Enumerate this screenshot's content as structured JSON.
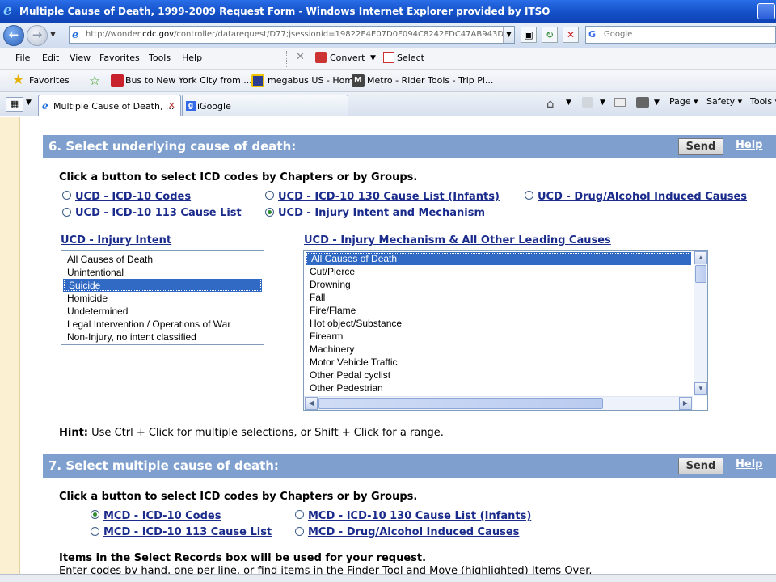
{
  "window": {
    "title": "Multiple Cause of Death, 1999-2009 Request Form - Windows Internet Explorer provided by ITSO"
  },
  "address": {
    "url_prefix": "http://wonder.",
    "url_domain": "cdc.gov",
    "url_rest": "/controller/datarequest/D77;jsessionid=19822E4E07D0F094C8242FDC47AB943D",
    "search_placeholder": "Google"
  },
  "menu": {
    "items": [
      "File",
      "Edit",
      "View",
      "Favorites",
      "Tools",
      "Help"
    ],
    "convert": "Convert",
    "select": "Select"
  },
  "favorites": {
    "label": "Favorites",
    "items": [
      "Bus to New York City from ...",
      "megabus US - Home",
      "Metro - Rider Tools - Trip Pl..."
    ]
  },
  "tabs": [
    {
      "label": "Multiple Cause of Death, ..."
    },
    {
      "label": "iGoogle"
    }
  ],
  "commandbar": {
    "page": "Page",
    "safety": "Safety",
    "tools": "Tools"
  },
  "section6": {
    "title": "6. Select underlying cause of death:",
    "send": "Send",
    "help": "Help",
    "instruction": "Click a button to select ICD codes by Chapters or by Groups.",
    "options": [
      {
        "label": "UCD - ICD-10 Codes",
        "selected": false
      },
      {
        "label": "UCD - ICD-10 130 Cause List (Infants)",
        "selected": false
      },
      {
        "label": "UCD - Drug/Alcohol Induced Causes",
        "selected": false
      },
      {
        "label": "UCD - ICD-10 113 Cause List",
        "selected": false
      },
      {
        "label": "UCD - Injury Intent and Mechanism",
        "selected": true
      }
    ],
    "intent_label": "UCD - Injury Intent",
    "intent_items": [
      "All Causes of Death",
      "Unintentional",
      "Suicide",
      "Homicide",
      "Undetermined",
      "Legal Intervention / Operations of War",
      "Non-Injury, no intent classified"
    ],
    "intent_selected": "Suicide",
    "mechanism_label": "UCD - Injury Mechanism & All Other Leading Causes",
    "mechanism_items": [
      "All Causes of Death",
      "Cut/Pierce",
      "Drowning",
      "Fall",
      "Fire/Flame",
      "Hot object/Substance",
      "Firearm",
      "Machinery",
      "Motor Vehicle Traffic",
      "Other Pedal cyclist",
      "Other Pedestrian"
    ],
    "mechanism_selected": "All Causes of Death",
    "hint_bold": "Hint:",
    "hint_text": " Use Ctrl + Click for multiple selections, or Shift + Click for a range."
  },
  "section7": {
    "title": "7. Select multiple cause of death:",
    "send": "Send",
    "help": "Help",
    "instruction": "Click a button to select ICD codes by Chapters or by Groups.",
    "options": [
      {
        "label": "MCD - ICD-10 Codes",
        "selected": true
      },
      {
        "label": "MCD - ICD-10 130 Cause List (Infants)",
        "selected": false
      },
      {
        "label": "MCD - ICD-10 113 Cause List",
        "selected": false
      },
      {
        "label": "MCD - Drug/Alcohol Induced Causes",
        "selected": false
      }
    ],
    "items_note": "Items in the Select Records box will be used for your request.",
    "enter_note": "Enter codes by hand, one per line, or find items in the Finder Tool and Move (highlighted) Items Over."
  }
}
